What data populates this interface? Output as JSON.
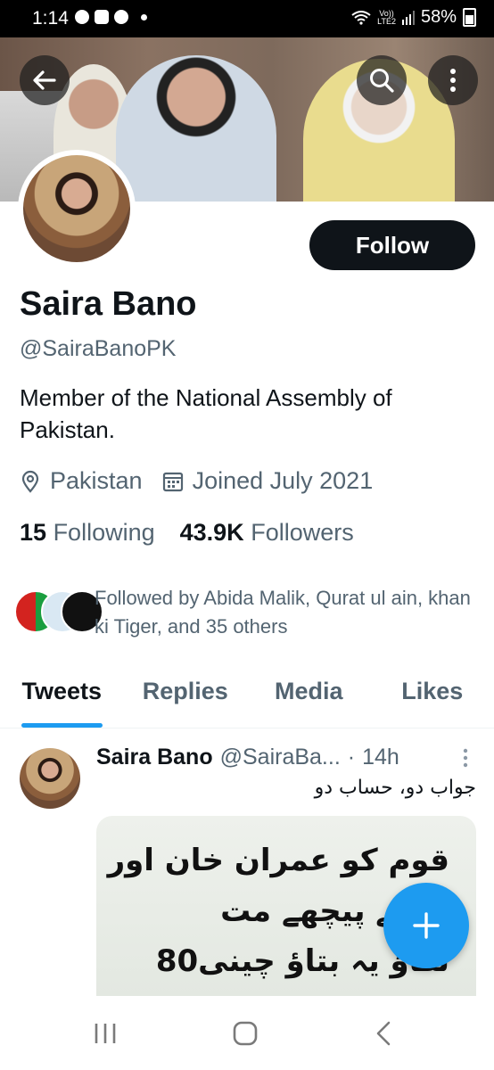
{
  "status_bar": {
    "time": "1:14",
    "network_label_top": "Vo))",
    "network_label_bottom": "LTE2",
    "battery": "58%"
  },
  "profile": {
    "name": "Saira Bano",
    "handle": "@SairaBanoPK",
    "bio": "Member of the National Assembly of Pakistan.",
    "location": "Pakistan",
    "joined": "Joined July 2021",
    "following_count": "15",
    "following_label": "Following",
    "followers_count": "43.9K",
    "followers_label": "Followers",
    "followed_by": "Followed by Abida Malik, Qurat ul ain, khan ki Tiger, and 35 others",
    "follow_button": "Follow"
  },
  "tabs": [
    "Tweets",
    "Replies",
    "Media",
    "Likes"
  ],
  "tweet": {
    "name": "Saira Bano",
    "handle": "@SairaBa...",
    "dot": "·",
    "time": "14h",
    "text": "جواب دو، حساب دو",
    "media_lines": [
      "قوم کو عمران خان اور",
      "ی کے پیچھے مت",
      "لگاؤ یہ بتاؤ چینی80"
    ]
  },
  "colors": {
    "accent": "#1d9bf0",
    "text_primary": "#0f1419",
    "text_secondary": "#536471",
    "button_dark": "#0f1419"
  },
  "icons": {
    "back": "arrow-left-icon",
    "search": "search-icon",
    "more": "more-vertical-icon",
    "location": "location-pin-icon",
    "calendar": "calendar-icon",
    "compose": "plus-icon",
    "nav_recents": "recents-icon",
    "nav_home": "home-icon",
    "nav_back": "chevron-left-icon"
  }
}
